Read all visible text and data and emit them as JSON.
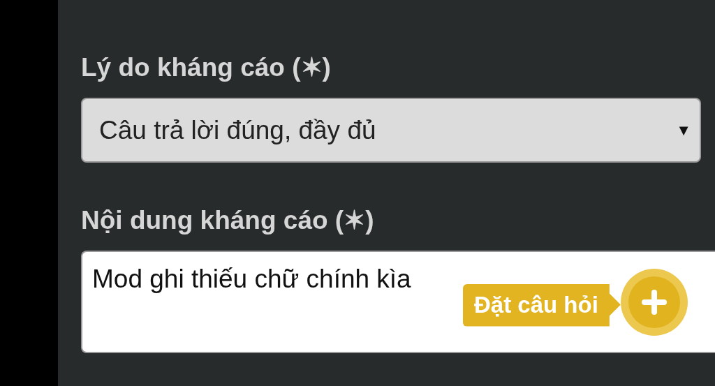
{
  "form": {
    "fields": [
      {
        "kind": "select",
        "label": "Lý do kháng cáo (✶)",
        "value": "Câu trả lời đúng, đầy đủ",
        "caret": "▼"
      },
      {
        "kind": "textarea",
        "label": "Nội dung kháng cáo (✶)",
        "value": "Mod ghi thiếu chữ chính kìa"
      }
    ]
  },
  "fab": {
    "label": "Đặt câu hỏi"
  }
}
